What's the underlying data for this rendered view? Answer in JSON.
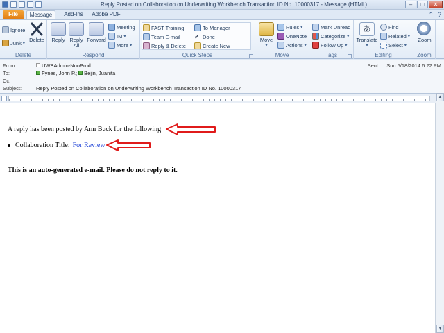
{
  "window": {
    "title": "Reply Posted on Collaboration on Underwriting Workbench Transaction ID No. 10000317  -  Message (HTML)",
    "controls": {
      "minimize": "–",
      "maximize": "□",
      "close": "✕"
    }
  },
  "tabs": [
    "File",
    "Message",
    "Add-Ins",
    "Adobe PDF"
  ],
  "ribbon": {
    "groups": {
      "delete": {
        "label": "Delete",
        "ignore": "Ignore",
        "junk": "Junk",
        "delete": "Delete"
      },
      "respond": {
        "label": "Respond",
        "reply": "Reply",
        "reply_all_1": "Reply",
        "reply_all_2": "All",
        "forward": "Forward",
        "meeting": "Meeting",
        "im": "IM",
        "more": "More"
      },
      "quick_steps": {
        "label": "Quick Steps",
        "items": [
          "FAST Training",
          "Team E-mail",
          "Reply & Delete",
          "To Manager",
          "Done",
          "Create New"
        ]
      },
      "move": {
        "label": "Move",
        "move": "Move",
        "rules": "Rules",
        "onenote": "OneNote",
        "actions": "Actions"
      },
      "tags": {
        "label": "Tags",
        "mark_unread": "Mark Unread",
        "categorize": "Categorize",
        "follow_up": "Follow Up"
      },
      "editing": {
        "label": "Editing",
        "translate": "Translate",
        "find": "Find",
        "related": "Related",
        "select": "Select"
      },
      "zoom": {
        "label": "Zoom",
        "zoom": "Zoom"
      }
    }
  },
  "header": {
    "from_label": "From:",
    "from_value": "UWBAdmin-NonProd",
    "to_label": "To:",
    "to_values": [
      "Fynes, John P.;",
      "Bejin, Juanita"
    ],
    "cc_label": "Cc:",
    "subject_label": "Subject:",
    "subject_value": "Reply Posted on Collaboration on Underwriting Workbench Transaction ID No. 10000317",
    "sent_label": "Sent:",
    "sent_value": "Sun 5/18/2014 6:22 PM"
  },
  "body": {
    "intro": "A reply has been posted by Ann Buck for the following",
    "bullet_label": "Collaboration Title:",
    "bullet_link": "For Review",
    "notice": "This is an auto-generated e-mail. Please do not reply to it."
  },
  "colors": {
    "file_tab": "#e07b12",
    "annotation_arrow": "#e01b1b",
    "link": "#1a3fd6"
  }
}
